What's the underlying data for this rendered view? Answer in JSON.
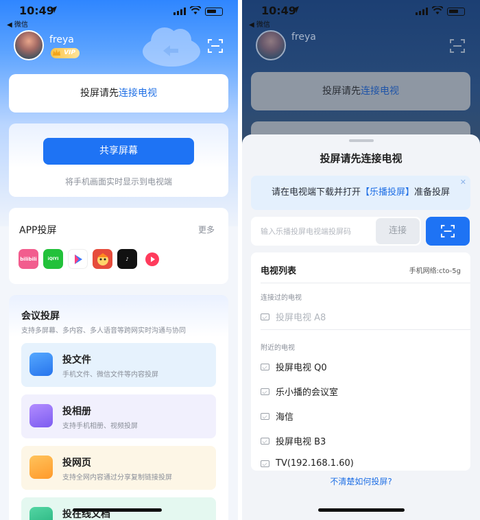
{
  "status": {
    "time": "10:49",
    "back_label": "◀ 微信"
  },
  "profile": {
    "name": "freya",
    "vip": "VIP"
  },
  "tip_card": {
    "prefix": "投屏请先",
    "link": "连接电视"
  },
  "share": {
    "button": "共享屏幕",
    "desc": "将手机画面实时显示到电视端"
  },
  "app_cast": {
    "title": "APP投屏",
    "more": "更多",
    "apps": [
      {
        "name": "bilibili",
        "text": "bilibili"
      },
      {
        "name": "iqiyi",
        "text": "iQIYI"
      },
      {
        "name": "youku",
        "text": "YOUKU"
      },
      {
        "name": "manga",
        "text": ""
      },
      {
        "name": "tiktok",
        "text": "♪"
      },
      {
        "name": "red",
        "text": ""
      }
    ]
  },
  "meeting": {
    "title": "会议投屏",
    "subtitle": "支持多屏幕、多内容、多人语音等跨网实时沟通与协同",
    "features": [
      {
        "name": "投文件",
        "desc": "手机文件、微信文件等内容投屏"
      },
      {
        "name": "投相册",
        "desc": "支持手机相册、视频投屏"
      },
      {
        "name": "投网页",
        "desc": "支持全网内容通过分享复制链接投屏"
      },
      {
        "name": "投在线文档",
        "desc": ""
      }
    ]
  },
  "sheet": {
    "title": "投屏请先连接电视",
    "banner": {
      "prefix": "请在电视端下载并打开",
      "link": "【乐播投屏】",
      "suffix": "准备投屏"
    },
    "code_placeholder": "输入乐播投屏电视端投屏码",
    "connect_label": "连接",
    "tv_list": {
      "title": "电视列表",
      "network": "手机网络:cto-5g",
      "connected_header": "连接过的电视",
      "connected": [
        "投屏电视 A8"
      ],
      "nearby_header": "附近的电视",
      "nearby": [
        "投屏电视 Q0",
        "乐小播的会议室",
        "海信",
        "投屏电视 B3",
        "TV(192.168.1.60)"
      ]
    },
    "help": "不清楚如何投屏?"
  },
  "colors": {
    "accent": "#1e73f4",
    "link": "#1f6fe5"
  }
}
